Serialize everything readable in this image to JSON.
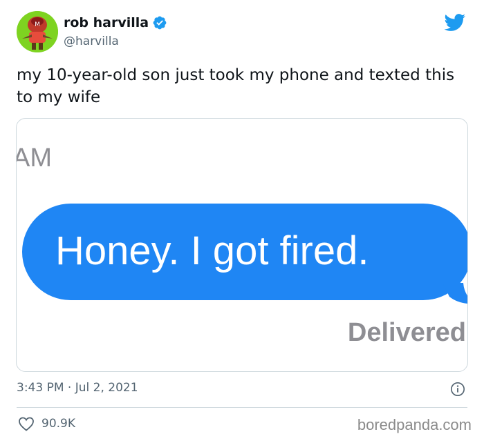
{
  "user": {
    "display_name": "rob harvilla",
    "handle": "@harvilla"
  },
  "tweet": {
    "text": "my 10-year-old son just took my phone and texted this to my wife",
    "timestamp": "3:43 PM · Jul 2, 2021",
    "likes": "90.9K"
  },
  "media": {
    "time_fragment": "AM",
    "message": "Honey. I got fired.",
    "status": "Delivered"
  },
  "watermark": "boredpanda.com",
  "icons": {
    "verified": "verified-badge-icon",
    "bird": "twitter-bird-icon",
    "info": "info-icon",
    "heart": "heart-icon"
  },
  "colors": {
    "twitter_blue": "#1d9bf0",
    "imessage_blue": "#1f86f4",
    "avatar_green": "#7ed321",
    "secondary_text": "#536471"
  }
}
